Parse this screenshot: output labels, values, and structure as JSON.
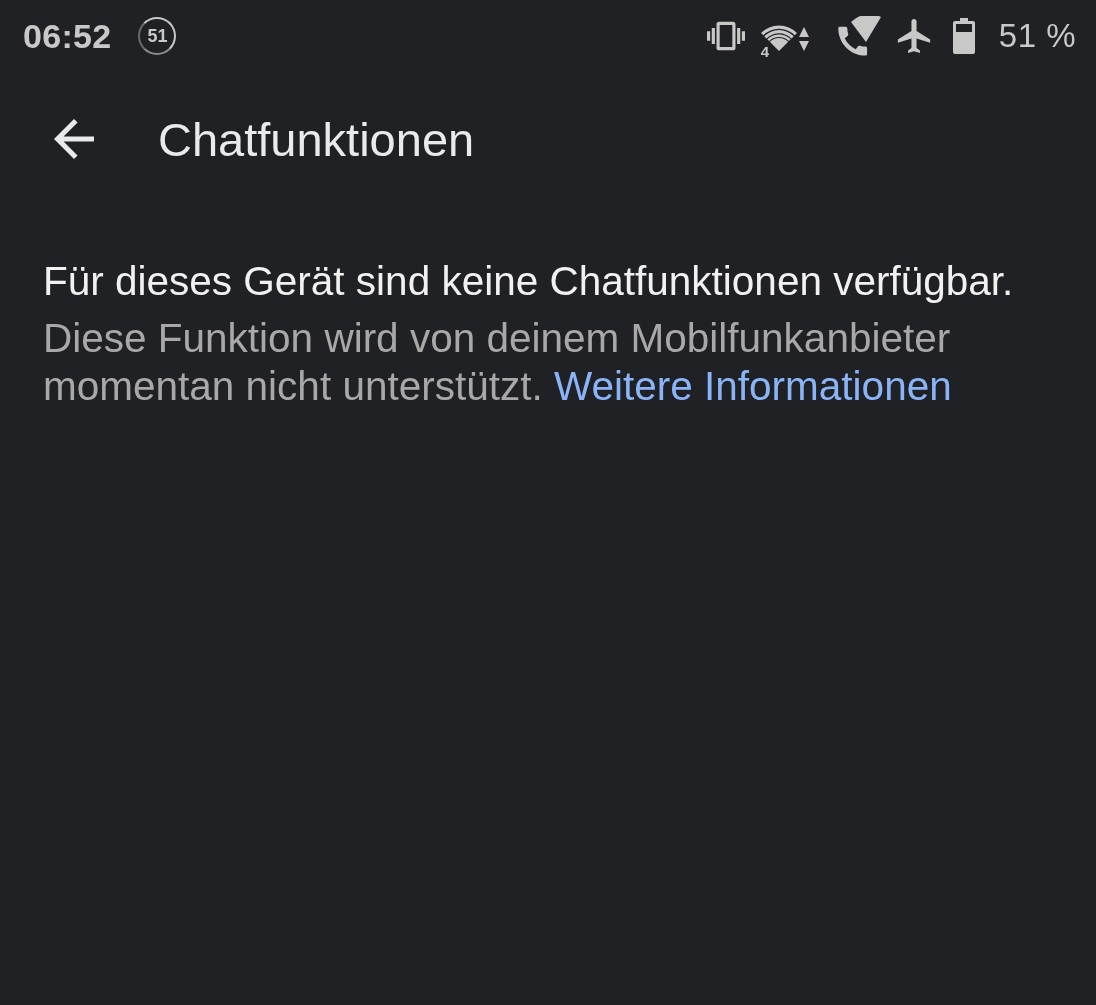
{
  "status_bar": {
    "time": "06:52",
    "notification_badge": "51",
    "wifi_label": "4",
    "battery_percent": "51 %"
  },
  "toolbar": {
    "title": "Chatfunktionen"
  },
  "message": {
    "heading": "Für dieses Gerät sind keine Chatfunktionen verfügbar.",
    "body": "Diese Funktion wird von deinem Mobilfunkanbieter momentan nicht unterstützt.",
    "link": "Weitere Informationen"
  }
}
